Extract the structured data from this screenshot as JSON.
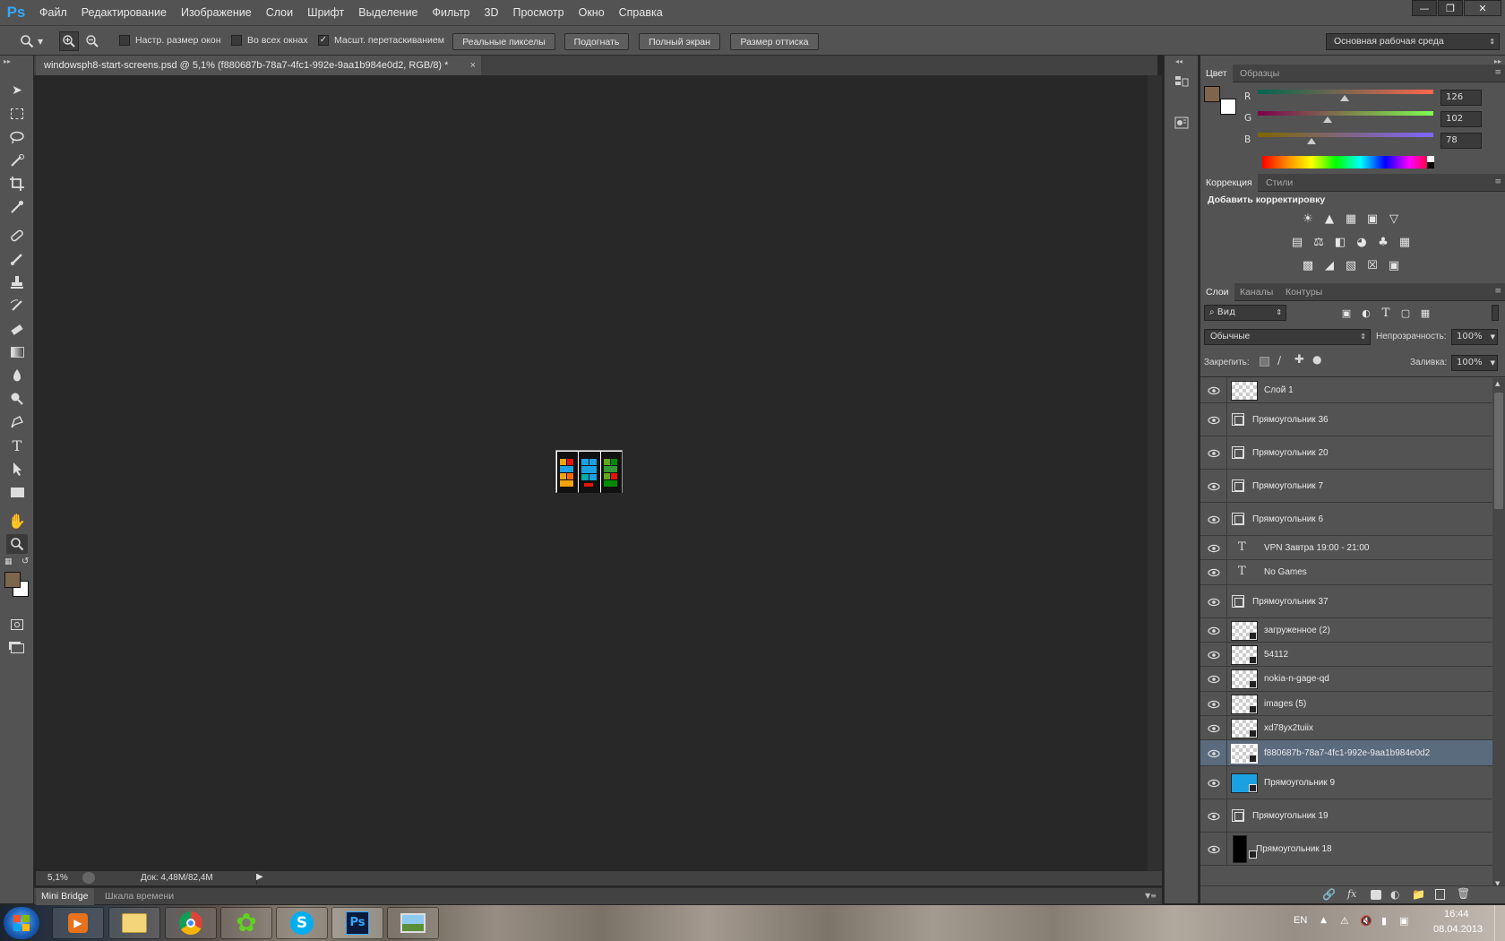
{
  "app": {
    "logo": "Ps",
    "menu": [
      "Файл",
      "Редактирование",
      "Изображение",
      "Слои",
      "Шрифт",
      "Выделение",
      "Фильтр",
      "3D",
      "Просмотр",
      "Окно",
      "Справка"
    ]
  },
  "options_bar": {
    "checkboxes": [
      {
        "label": "Настр. размер окон",
        "checked": false
      },
      {
        "label": "Во всех окнах",
        "checked": false
      },
      {
        "label": "Масшт. перетаскиванием",
        "checked": true
      }
    ],
    "buttons": [
      "Реальные пикселы",
      "Подогнать",
      "Полный экран",
      "Размер оттиска"
    ],
    "workspace": "Основная рабочая среда"
  },
  "document": {
    "tab_title": "windowsph8-start-screens.psd @ 5,1% (f880687b-78a7-4fc1-992e-9aa1b984e0d2, RGB/8) *",
    "close": "×",
    "zoom": "5,1%",
    "doc_size": "Док: 4,48M/82,4M"
  },
  "bottom_tabs": [
    "Mini Bridge",
    "Шкала времени"
  ],
  "color_panel": {
    "tabs": [
      "Цвет",
      "Образцы"
    ],
    "fg": "#7e664e",
    "bg": "#ffffff",
    "channels": [
      {
        "label": "R",
        "value": "126",
        "fraction": 0.494
      },
      {
        "label": "G",
        "value": "102",
        "fraction": 0.4
      },
      {
        "label": "B",
        "value": "78",
        "fraction": 0.306
      }
    ]
  },
  "adjustments_panel": {
    "tabs": [
      "Коррекция",
      "Стили"
    ],
    "title": "Добавить корректировку"
  },
  "layers_panel": {
    "tabs": [
      "Слои",
      "Каналы",
      "Контуры"
    ],
    "filter": "Вид",
    "blend_mode": "Обычные",
    "opacity_label": "Непрозрачность:",
    "opacity": "100%",
    "lock_label": "Закрепить:",
    "fill_label": "Заливка:",
    "fill": "100%",
    "layers": [
      {
        "name": "Слой 1",
        "kind": "pixel"
      },
      {
        "name": "Прямоугольник 36",
        "kind": "shape"
      },
      {
        "name": "Прямоугольник 20",
        "kind": "shape"
      },
      {
        "name": "Прямоугольник 7",
        "kind": "shape"
      },
      {
        "name": "Прямоугольник 6",
        "kind": "shape"
      },
      {
        "name": "VPN Завтра 19:00 - 21:00",
        "kind": "text"
      },
      {
        "name": "No Games",
        "kind": "text"
      },
      {
        "name": "Прямоугольник 37",
        "kind": "shape"
      },
      {
        "name": "загруженное (2)",
        "kind": "smart"
      },
      {
        "name": "54112",
        "kind": "smart"
      },
      {
        "name": "nokia-n-gage-qd",
        "kind": "smart"
      },
      {
        "name": "images (5)",
        "kind": "smart"
      },
      {
        "name": "xd78yx2tuiix",
        "kind": "smart"
      },
      {
        "name": "f880687b-78a7-4fc1-992e-9aa1b984e0d2",
        "kind": "smart",
        "selected": true
      },
      {
        "name": "Прямоугольник 9",
        "kind": "blue"
      },
      {
        "name": "Прямоугольник 19",
        "kind": "shape"
      },
      {
        "name": "Прямоугольник 18",
        "kind": "black"
      }
    ]
  },
  "taskbar": {
    "lang": "EN",
    "time": "16:44",
    "date": "08.04.2013"
  }
}
